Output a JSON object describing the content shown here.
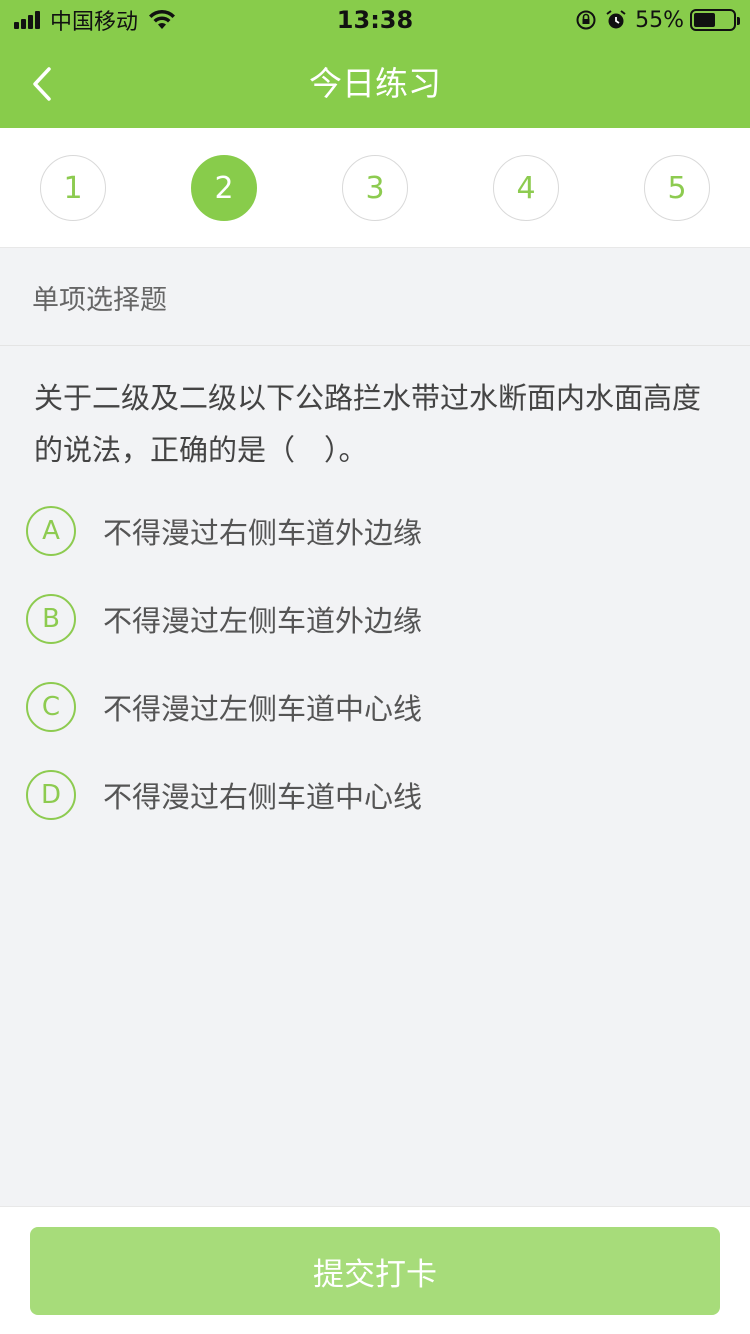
{
  "status_bar": {
    "carrier": "中国移动",
    "time": "13:38",
    "battery_percent": "55%",
    "battery_level": 0.55
  },
  "nav": {
    "title": "今日练习",
    "back_icon": "chevron-left-icon"
  },
  "question_tabs": [
    {
      "label": "1",
      "active": false
    },
    {
      "label": "2",
      "active": true
    },
    {
      "label": "3",
      "active": false
    },
    {
      "label": "4",
      "active": false
    },
    {
      "label": "5",
      "active": false
    }
  ],
  "question": {
    "type": "单项选择题",
    "line1": "关于二级及二级以下公路拦水带过水断面内水面高度",
    "line2": "的说法，正确的是（　）。",
    "options": [
      {
        "letter": "A",
        "text": "不得漫过右侧车道外边缘"
      },
      {
        "letter": "B",
        "text": "不得漫过左侧车道外边缘"
      },
      {
        "letter": "C",
        "text": "不得漫过左侧车道中心线"
      },
      {
        "letter": "D",
        "text": "不得漫过右侧车道中心线"
      }
    ]
  },
  "footer": {
    "submit_label": "提交打卡"
  },
  "colors": {
    "brand_green": "#88cc4b",
    "button_green_disabled": "#a7dc7a"
  }
}
